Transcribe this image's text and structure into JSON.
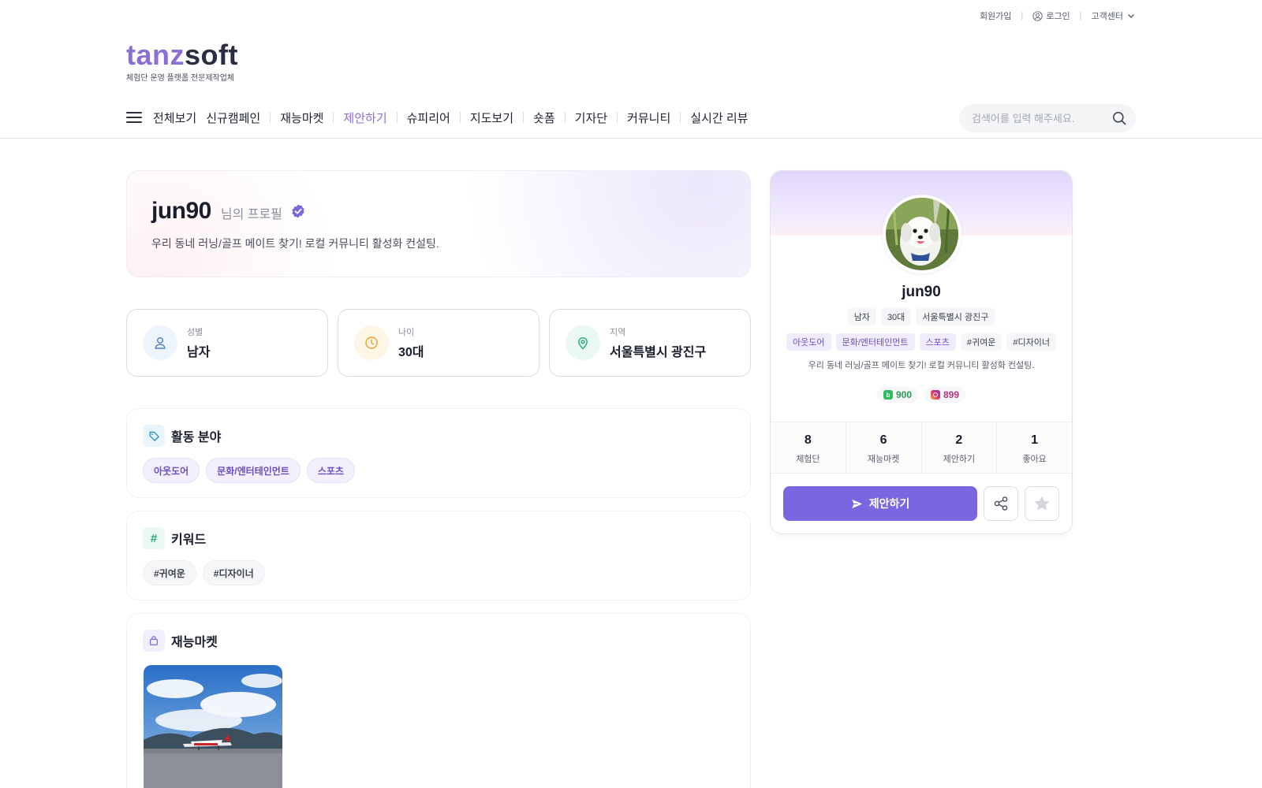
{
  "util": {
    "signup": "회원가입",
    "login": "로그인",
    "support": "고객센터"
  },
  "logo": {
    "part1": "tanz",
    "part2": "soft",
    "tagline": "체험단 운영 플랫폼 전문제작업체"
  },
  "nav": {
    "items": [
      "전체보기",
      "신규캠페인",
      "재능마켓",
      "제안하기",
      "슈피리어",
      "지도보기",
      "숏폼",
      "기자단",
      "커뮤니티",
      "실시간 리뷰"
    ],
    "active_index": 3
  },
  "search": {
    "placeholder": "검색어를 입력 해주세요."
  },
  "hero": {
    "username": "jun90",
    "suffix": "님의 프로필",
    "description": "우리 동네 러닝/골프 메이트 찾기! 로컬 커뮤니티 활성화 컨설팅."
  },
  "info": {
    "gender": {
      "label": "성별",
      "value": "남자"
    },
    "age": {
      "label": "나이",
      "value": "30대"
    },
    "region": {
      "label": "지역",
      "value": "서울특별시 광진구"
    }
  },
  "fields": {
    "title": "활동 분야",
    "items": [
      "아웃도어",
      "문화/엔터테인먼트",
      "스포츠"
    ]
  },
  "keywords": {
    "title": "키워드",
    "items": [
      "#귀여운",
      "#디자이너"
    ]
  },
  "talent": {
    "title": "재능마켓"
  },
  "card": {
    "name": "jun90",
    "meta": [
      "남자",
      "30대",
      "서울특별시 광진구"
    ],
    "category_tags": [
      "아웃도어",
      "문화/엔터테인먼트",
      "스포츠"
    ],
    "keyword_tags": [
      "#귀여운",
      "#디자이너"
    ],
    "description": "우리 동네 러닝/골프 메이트 찾기! 로컬 커뮤니티 활성화 컨설팅.",
    "blog_icon_letter": "b",
    "blog_count": "900",
    "insta_count": "899",
    "stats": [
      {
        "num": "8",
        "label": "체험단"
      },
      {
        "num": "6",
        "label": "재능마켓"
      },
      {
        "num": "2",
        "label": "제안하기"
      },
      {
        "num": "1",
        "label": "좋아요"
      }
    ],
    "propose_label": "제안하기"
  },
  "colors": {
    "accent": "#7c66e0",
    "logo_accent": "#8b6fd6",
    "blog": "#2dbe60",
    "chip_purple_text": "#6a4fc4"
  }
}
